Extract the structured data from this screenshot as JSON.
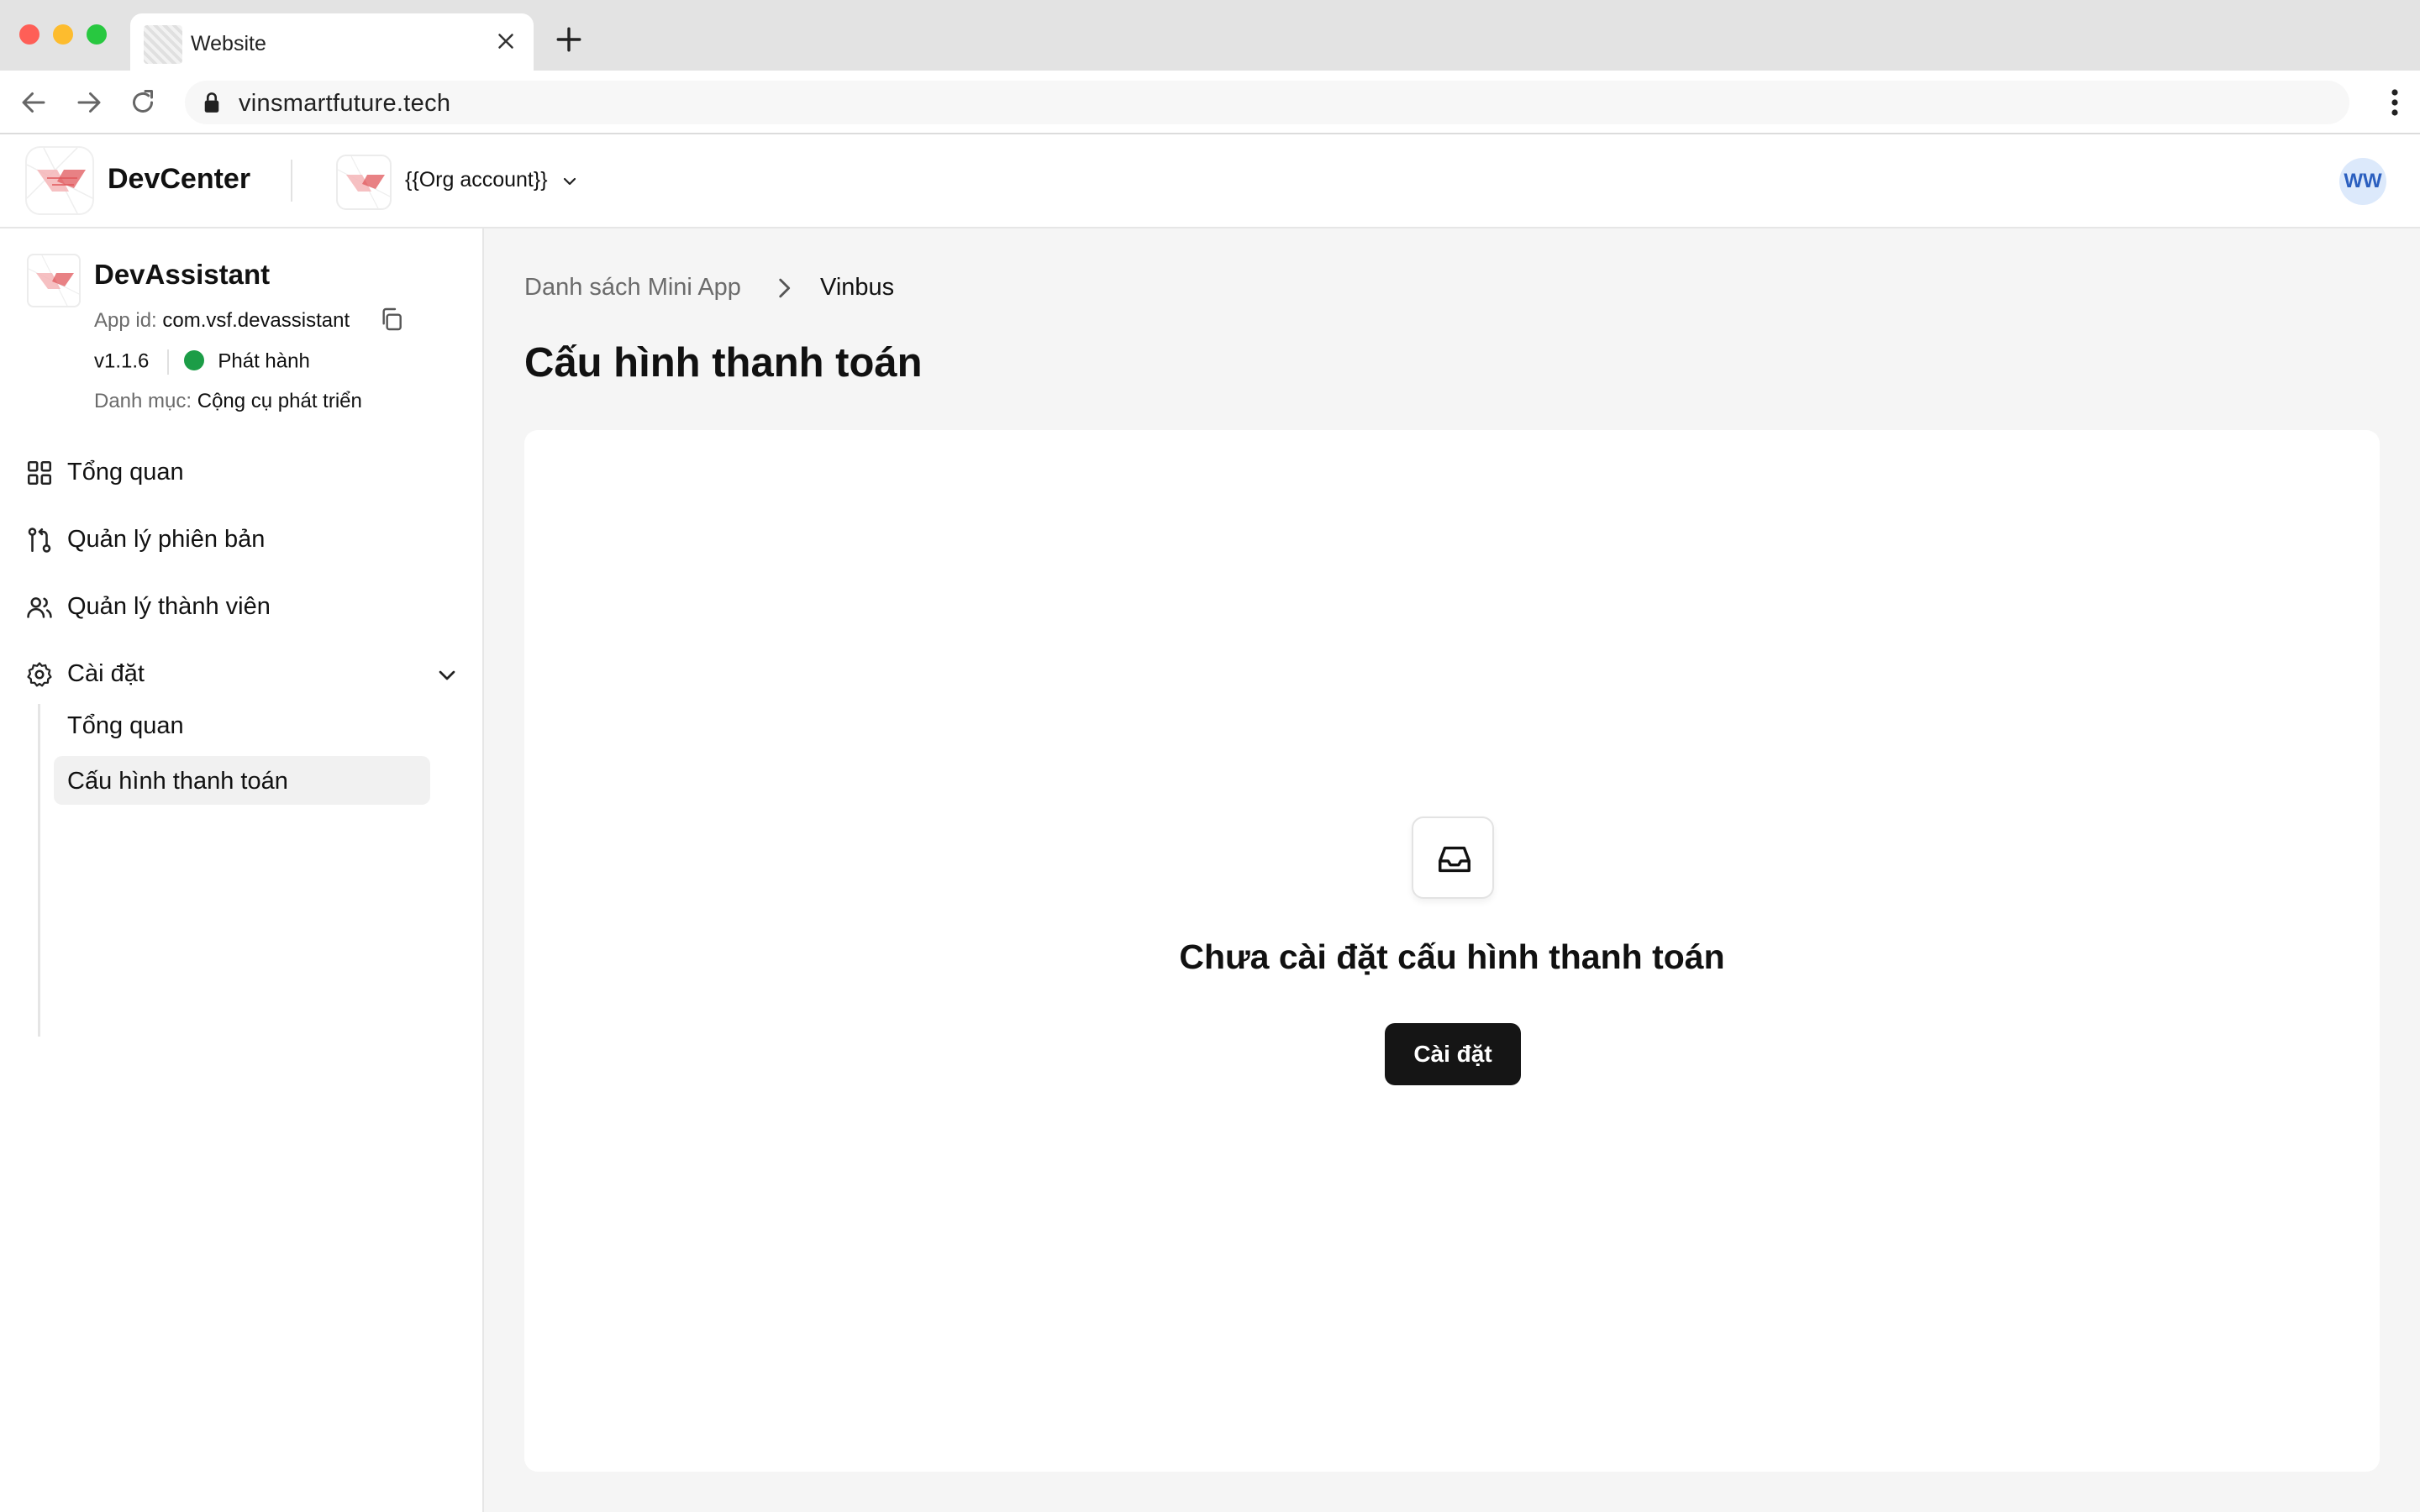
{
  "browser": {
    "tab_title": "Website",
    "url": "vinsmartfuture.tech"
  },
  "header": {
    "brand_name": "DevCenter",
    "org_name": "{{Org account}}",
    "avatar_initials": "WW"
  },
  "sidebar": {
    "app": {
      "name": "DevAssistant",
      "app_id_label": "App id:",
      "app_id_value": "com.vsf.devassistant",
      "version": "v1.1.6",
      "status": "Phát hành",
      "status_color": "#1c9d47",
      "category_label": "Danh mục:",
      "category_value": "Cộng cụ phát triển"
    },
    "items": [
      {
        "label": "Tổng quan",
        "icon": "grid-icon"
      },
      {
        "label": "Quản lý phiên bản",
        "icon": "git-branch-icon"
      },
      {
        "label": "Quản lý thành viên",
        "icon": "users-icon"
      },
      {
        "label": "Cài đặt",
        "icon": "gear-icon"
      }
    ],
    "settings_subitems": [
      {
        "label": "Tổng quan",
        "active": false
      },
      {
        "label": "Cấu hình thanh toán",
        "active": true
      }
    ]
  },
  "main": {
    "breadcrumb": [
      "Danh sách Mini App",
      "Vinbus"
    ],
    "title": "Cấu hình thanh toán",
    "empty_state": {
      "icon": "inbox-icon",
      "message": "Chưa cài đặt cấu hình thanh toán",
      "button_label": "Cài đặt"
    }
  },
  "colors": {
    "accent_dark": "#151515",
    "logo_red": "#e0575b",
    "avatar_bg": "#dce9fb"
  }
}
